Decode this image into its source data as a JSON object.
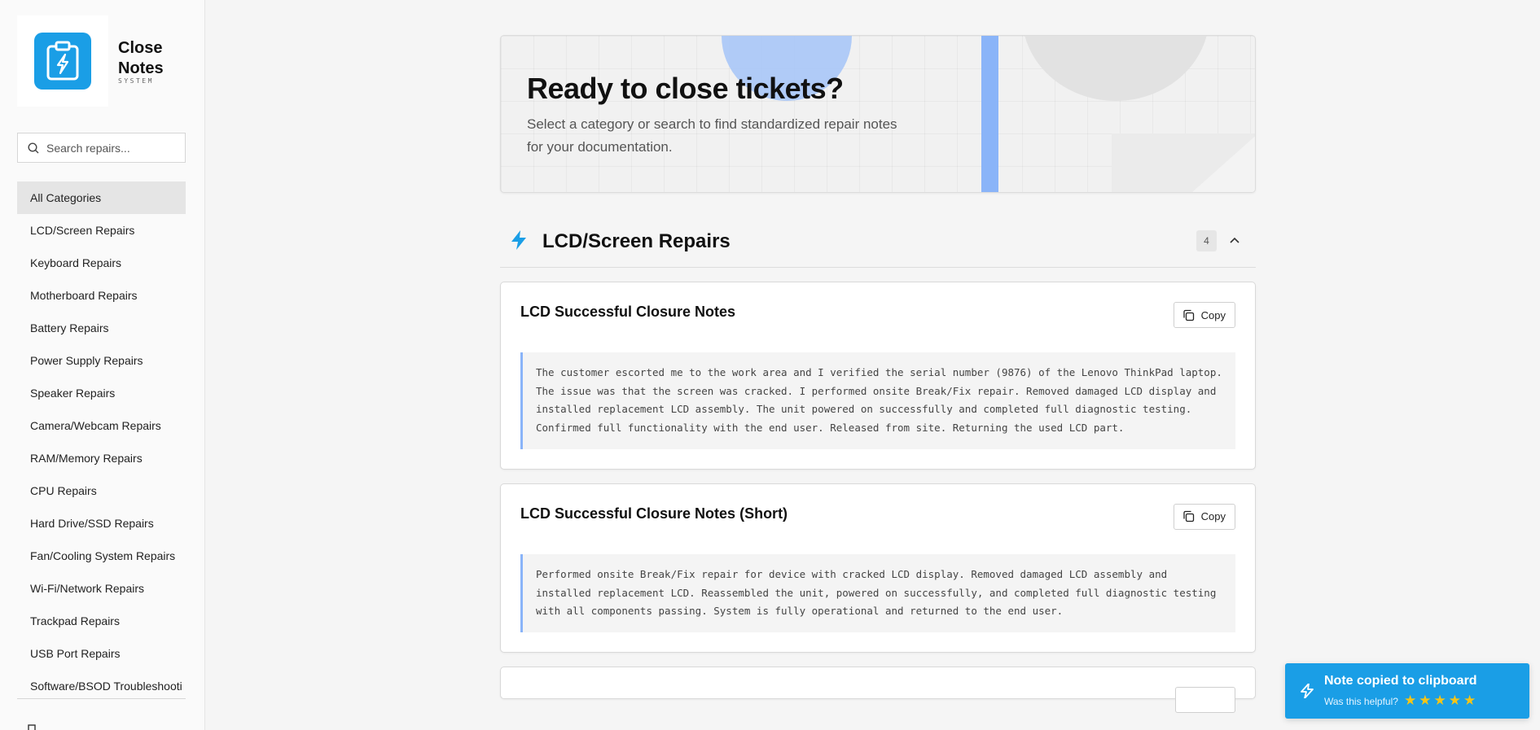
{
  "brand": {
    "name_line1": "Close",
    "name_line2": "Notes",
    "sub": "SYSTEM"
  },
  "search": {
    "placeholder": "Search repairs..."
  },
  "sidebar": {
    "items": [
      {
        "label": "All Categories",
        "active": true
      },
      {
        "label": "LCD/Screen Repairs"
      },
      {
        "label": "Keyboard Repairs"
      },
      {
        "label": "Motherboard Repairs"
      },
      {
        "label": "Battery Repairs"
      },
      {
        "label": "Power Supply Repairs"
      },
      {
        "label": "Speaker Repairs"
      },
      {
        "label": "Camera/Webcam Repairs"
      },
      {
        "label": "RAM/Memory Repairs"
      },
      {
        "label": "CPU Repairs"
      },
      {
        "label": "Hard Drive/SSD Repairs"
      },
      {
        "label": "Fan/Cooling System Repairs"
      },
      {
        "label": "Wi-Fi/Network Repairs"
      },
      {
        "label": "Trackpad Repairs"
      },
      {
        "label": "USB Port Repairs"
      },
      {
        "label": "Software/BSOD Troubleshooti"
      }
    ]
  },
  "hero": {
    "title": "Ready to close tickets?",
    "subtitle": "Select a category or search to find standardized repair notes for your documentation."
  },
  "section": {
    "title": "LCD/Screen Repairs",
    "count": "4",
    "icon": "bolt-icon",
    "accent": "#1a9ee6"
  },
  "cards": [
    {
      "title": "LCD Successful Closure Notes",
      "copy_label": "Copy",
      "body": "The customer escorted me to the work area and I verified the serial number (9876) of the Lenovo ThinkPad laptop. The issue was that the screen was cracked. I performed onsite Break/Fix repair. Removed damaged LCD display and installed replacement LCD assembly. The unit powered on successfully and completed full diagnostic testing. Confirmed full functionality with the end user. Released from site. Returning the used LCD part."
    },
    {
      "title": "LCD Successful Closure Notes (Short)",
      "copy_label": "Copy",
      "body": "Performed onsite Break/Fix repair for device with cracked LCD display. Removed damaged LCD assembly and installed replacement LCD. Reassembled the unit, powered on successfully, and completed full diagnostic testing with all components passing. System is fully operational and returned to the end user."
    }
  ],
  "toast": {
    "title": "Note copied to clipboard",
    "prompt": "Was this helpful?",
    "rating_max": 5,
    "star_glyph": "★",
    "color": "#1a9ee6"
  }
}
